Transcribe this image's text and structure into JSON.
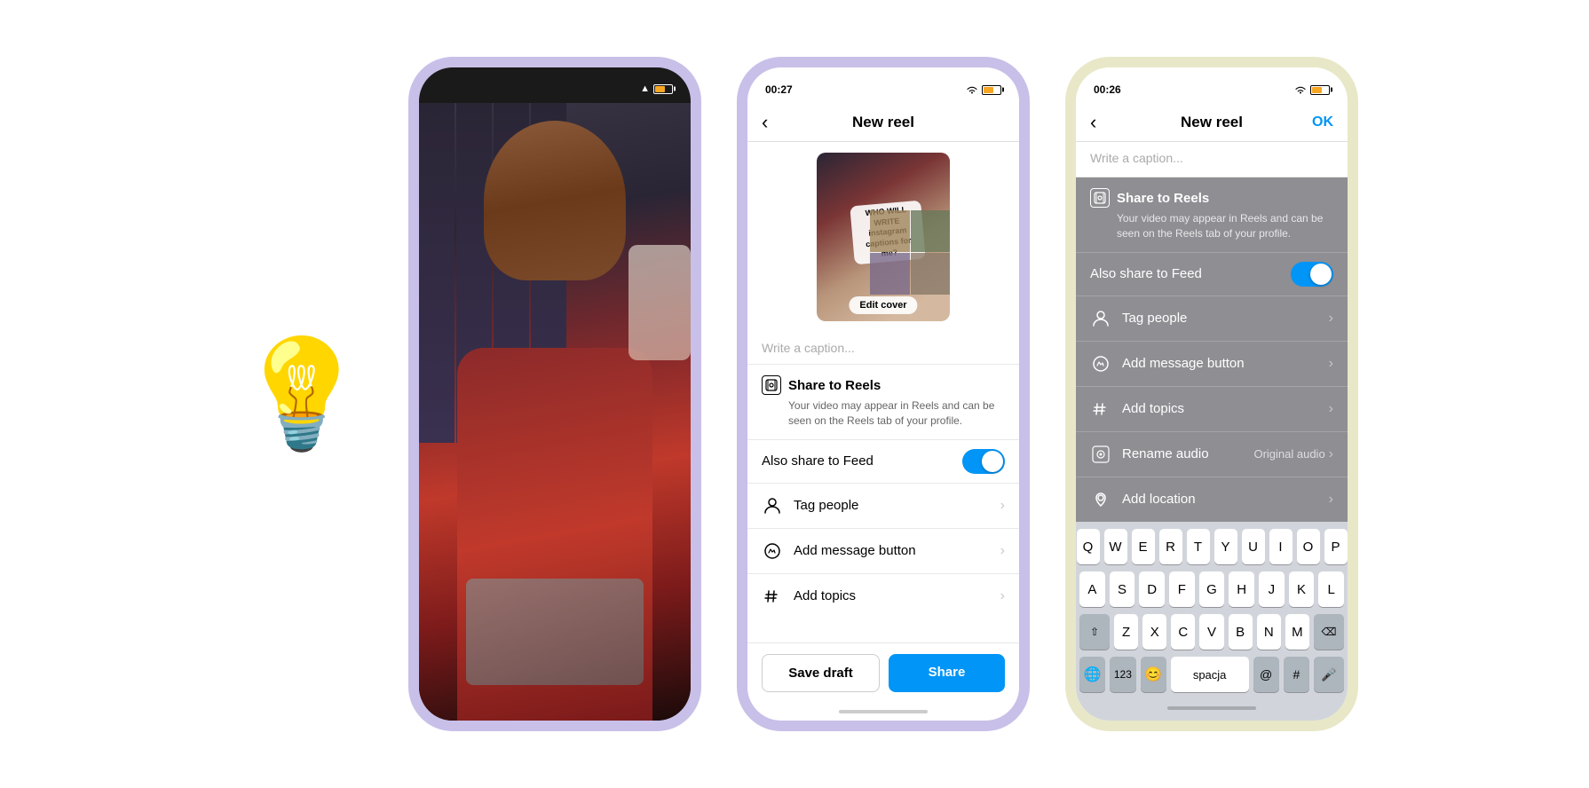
{
  "scene": {
    "background": "#ffffff"
  },
  "lightbulb": {
    "emoji": "💡"
  },
  "phone1": {
    "notch": true,
    "status": {},
    "content": "photo"
  },
  "phone2": {
    "status_bar": {
      "time": "00:27",
      "wifi": true,
      "battery": true
    },
    "nav": {
      "back": "‹",
      "title": "New reel",
      "ok": null
    },
    "thumbnail": {
      "edit_cover_label": "Edit cover"
    },
    "caption_placeholder": "Write a caption...",
    "share_to_reels": {
      "title": "Share to Reels",
      "subtitle": "Your video may appear in Reels and can be seen on the Reels tab of your profile."
    },
    "also_share_to_feed": {
      "label": "Also share to Feed",
      "toggled": true
    },
    "list_items": [
      {
        "icon": "person-icon",
        "label": "Tag people",
        "value": "",
        "has_chevron": true
      },
      {
        "icon": "message-icon",
        "label": "Add message button",
        "value": "",
        "has_chevron": true
      },
      {
        "icon": "add-icon",
        "label": "Add topics",
        "value": "",
        "has_chevron": true
      }
    ],
    "buttons": {
      "save_draft": "Save draft",
      "share": "Share"
    }
  },
  "phone3": {
    "status_bar": {
      "time": "00:26",
      "arrow": "↑",
      "wifi": true,
      "battery": true
    },
    "nav": {
      "back": "‹",
      "title": "New reel",
      "ok": "OK"
    },
    "caption_placeholder": "Write a caption...",
    "share_to_reels": {
      "title": "Share to Reels",
      "subtitle": "Your video may appear in Reels and can be seen on the Reels tab of your profile."
    },
    "also_share_to_feed": {
      "label": "Also share to Feed",
      "toggled": true
    },
    "list_items": [
      {
        "icon": "person-icon",
        "label": "Tag people",
        "value": "",
        "has_chevron": true
      },
      {
        "icon": "message-icon",
        "label": "Add message button",
        "value": "",
        "has_chevron": true
      },
      {
        "icon": "hash-icon",
        "label": "Add topics",
        "value": "",
        "has_chevron": true
      },
      {
        "icon": "music-icon",
        "label": "Rename audio",
        "value": "Original audio",
        "has_chevron": true
      },
      {
        "icon": "location-icon",
        "label": "Add location",
        "value": "",
        "has_chevron": true
      }
    ],
    "keyboard": {
      "rows": [
        [
          "Q",
          "W",
          "E",
          "R",
          "T",
          "Y",
          "U",
          "I",
          "O",
          "P"
        ],
        [
          "A",
          "S",
          "D",
          "F",
          "G",
          "H",
          "J",
          "K",
          "L"
        ],
        [
          "⇧",
          "Z",
          "X",
          "C",
          "V",
          "B",
          "N",
          "M",
          "⌫"
        ],
        [
          "123",
          "😊",
          "spacja",
          "@",
          "#"
        ]
      ],
      "bottom_row": [
        "🌐",
        "⎙"
      ]
    }
  }
}
